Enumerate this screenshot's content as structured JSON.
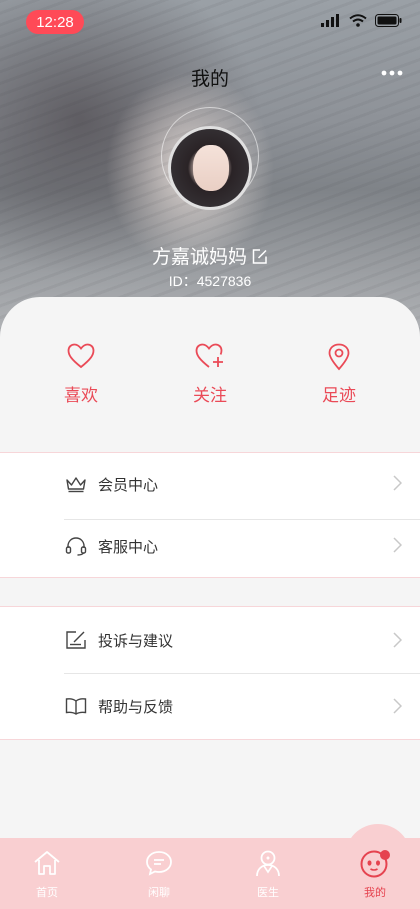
{
  "status": {
    "time": "12:28"
  },
  "header": {
    "title": "我的"
  },
  "profile": {
    "nickname": "方嘉诚妈妈",
    "id_text": "ID：4527836"
  },
  "quick": [
    {
      "label": "喜欢",
      "icon": "heart-icon"
    },
    {
      "label": "关注",
      "icon": "heart-plus-icon"
    },
    {
      "label": "足迹",
      "icon": "location-pin-icon"
    }
  ],
  "menu_group1": [
    {
      "label": "会员中心",
      "icon": "crown-icon"
    },
    {
      "label": "客服中心",
      "icon": "headset-icon"
    }
  ],
  "menu_group2": [
    {
      "label": "投诉与建议",
      "icon": "feedback-edit-icon"
    },
    {
      "label": "帮助与反馈",
      "icon": "book-icon"
    }
  ],
  "tabs": [
    {
      "label": "首页",
      "icon": "home-icon"
    },
    {
      "label": "闲聊",
      "icon": "chat-icon"
    },
    {
      "label": "医生",
      "icon": "doctor-icon"
    },
    {
      "label": "我的",
      "icon": "mascot-icon",
      "active": true
    }
  ],
  "colors": {
    "accent": "#ea4a57",
    "tabbar": "#f9cfd1",
    "time_pill": "#ff4a57"
  }
}
